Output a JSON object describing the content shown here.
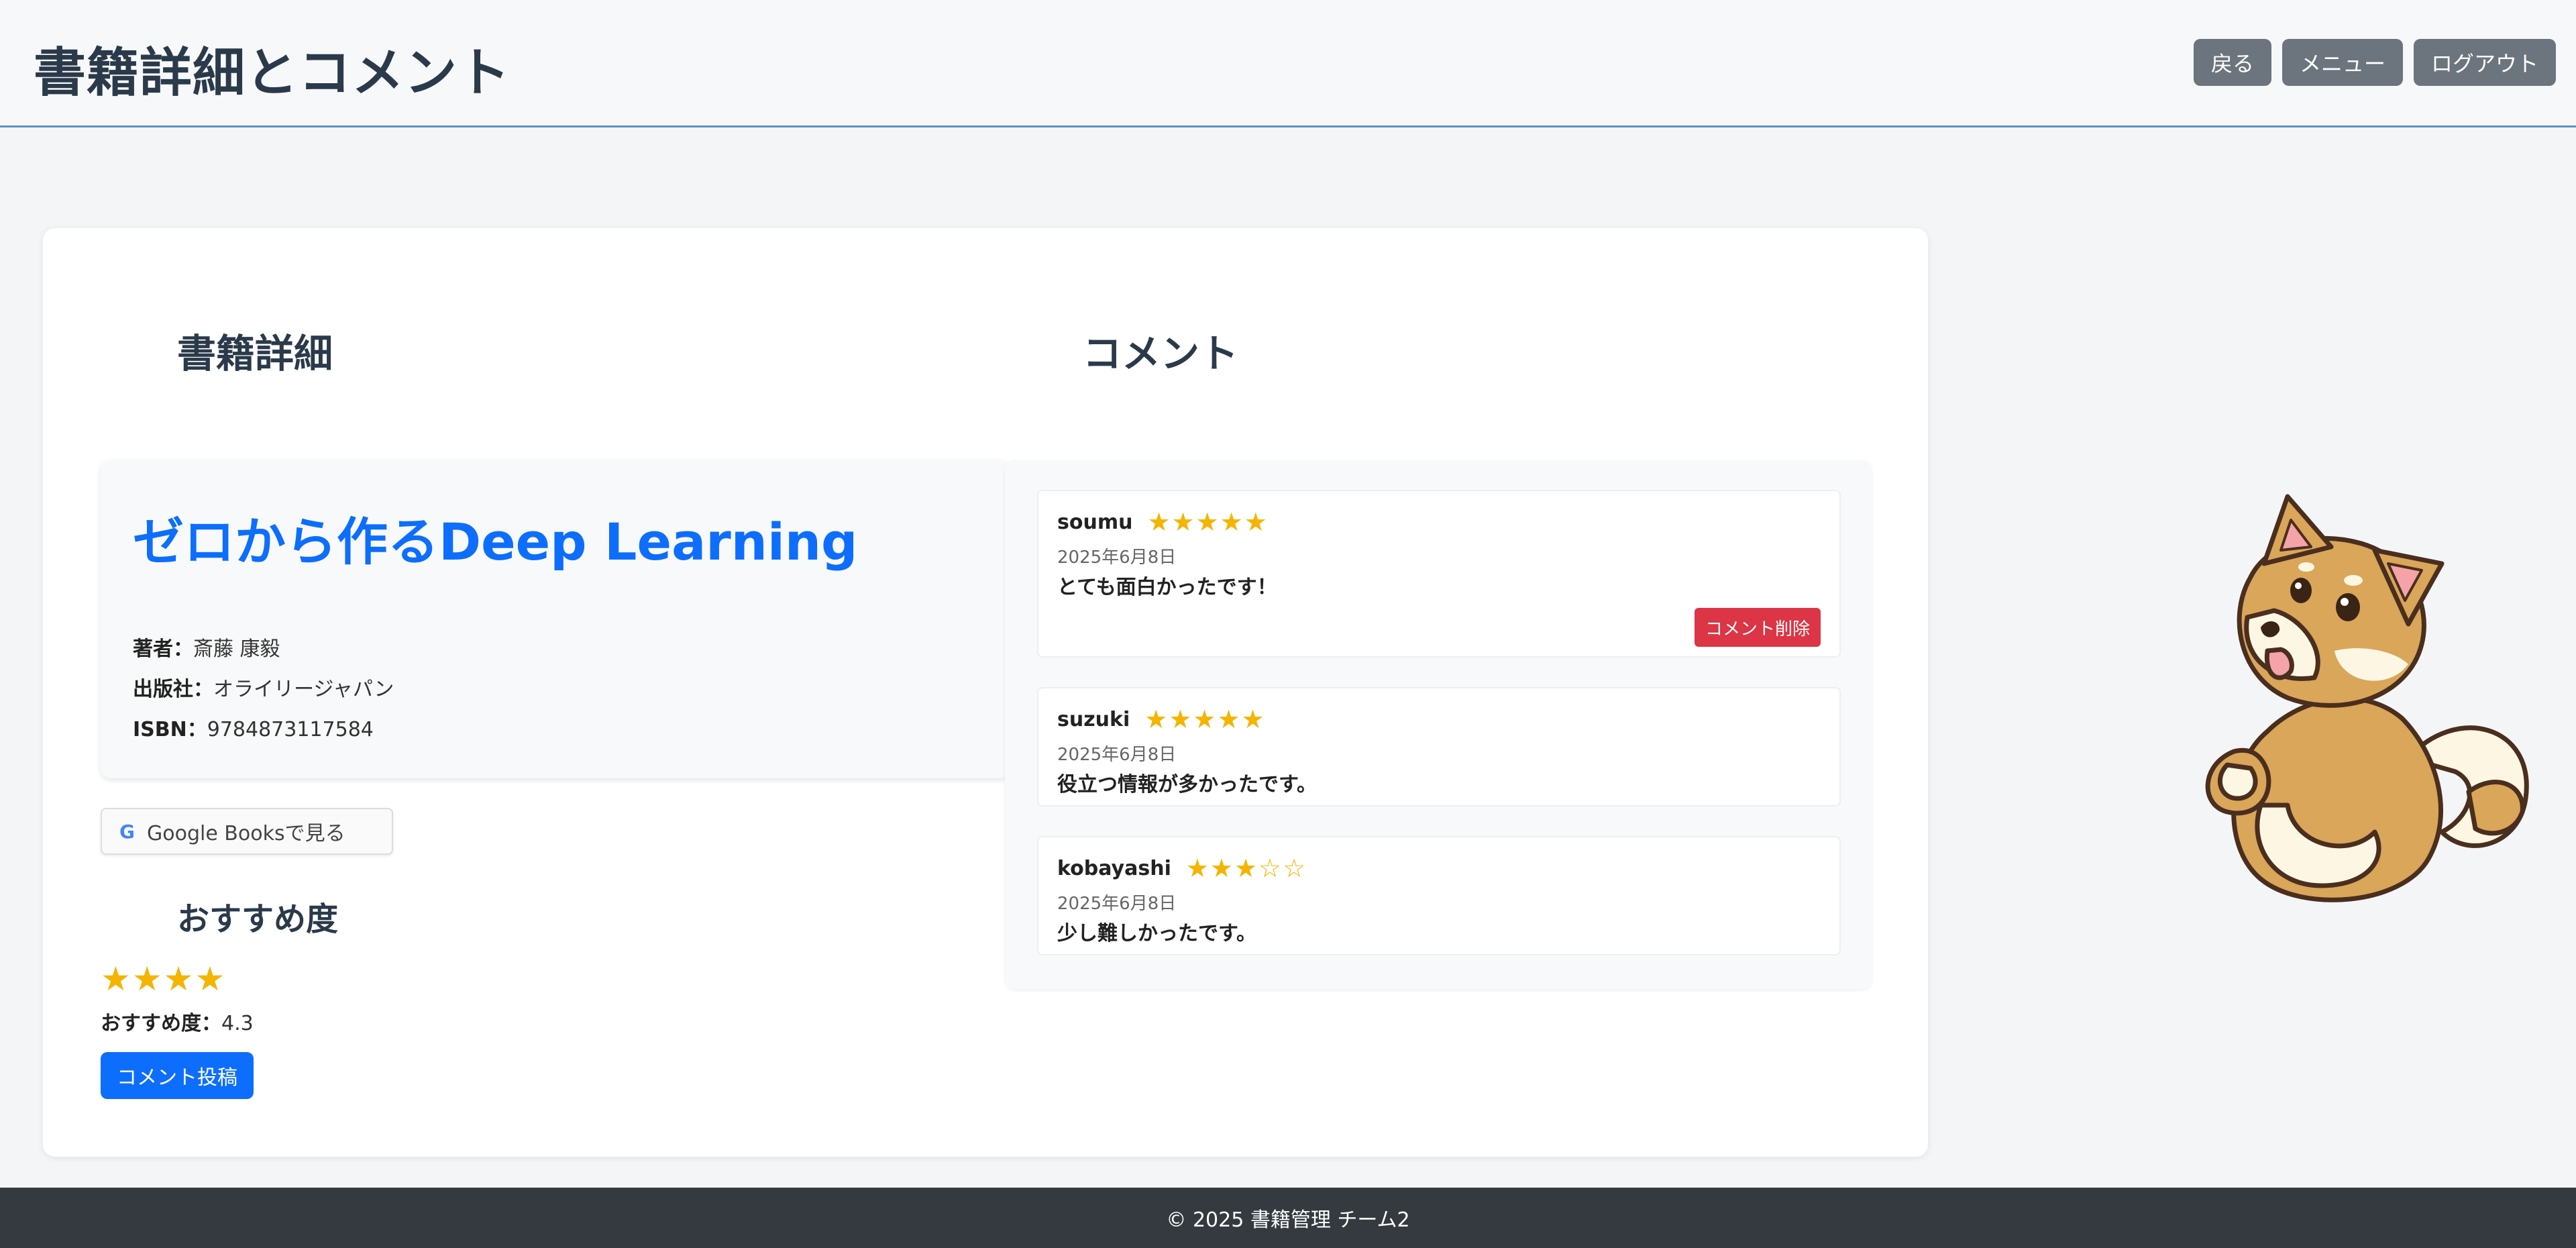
{
  "header": {
    "title": "書籍詳細とコメント",
    "buttons": {
      "back": "戻る",
      "menu": "メニュー",
      "logout": "ログアウト"
    }
  },
  "sections": {
    "book_detail": "書籍詳細",
    "comments": "コメント"
  },
  "book": {
    "title": "ゼロから作るDeep Learning",
    "author_label": "著者：",
    "author": "斎藤 康毅",
    "publisher_label": "出版社：",
    "publisher": "オライリージャパン",
    "isbn_label": "ISBN：",
    "isbn": "9784873117584"
  },
  "google_books_button": {
    "icon": "G",
    "label": "Google Booksで見る"
  },
  "recommendation": {
    "heading": "おすすめ度",
    "stars": "★★★★",
    "score_label": "おすすめ度：",
    "score": "4.3",
    "star_color": "#f5b400"
  },
  "post_comment_button": "コメント投稿",
  "comments": [
    {
      "user": "soumu",
      "stars": "★★★★★",
      "rating": 5,
      "date": "2025年6月8日",
      "text": "とても面白かったです！",
      "delete_label": "コメント削除"
    },
    {
      "user": "suzuki",
      "stars": "★★★★★",
      "rating": 5,
      "date": "2025年6月8日",
      "text": "役立つ情報が多かったです。"
    },
    {
      "user": "kobayashi",
      "stars": "★★★☆☆",
      "rating": 3,
      "date": "2025年6月8日",
      "text": "少し難しかったです。"
    }
  ],
  "footer": {
    "copyright": "© 2025 書籍管理 チーム2"
  },
  "colors": {
    "accent": "#0d6efd",
    "danger": "#dc3545",
    "secondary": "#6c757d",
    "footer_bg": "#343a40"
  }
}
